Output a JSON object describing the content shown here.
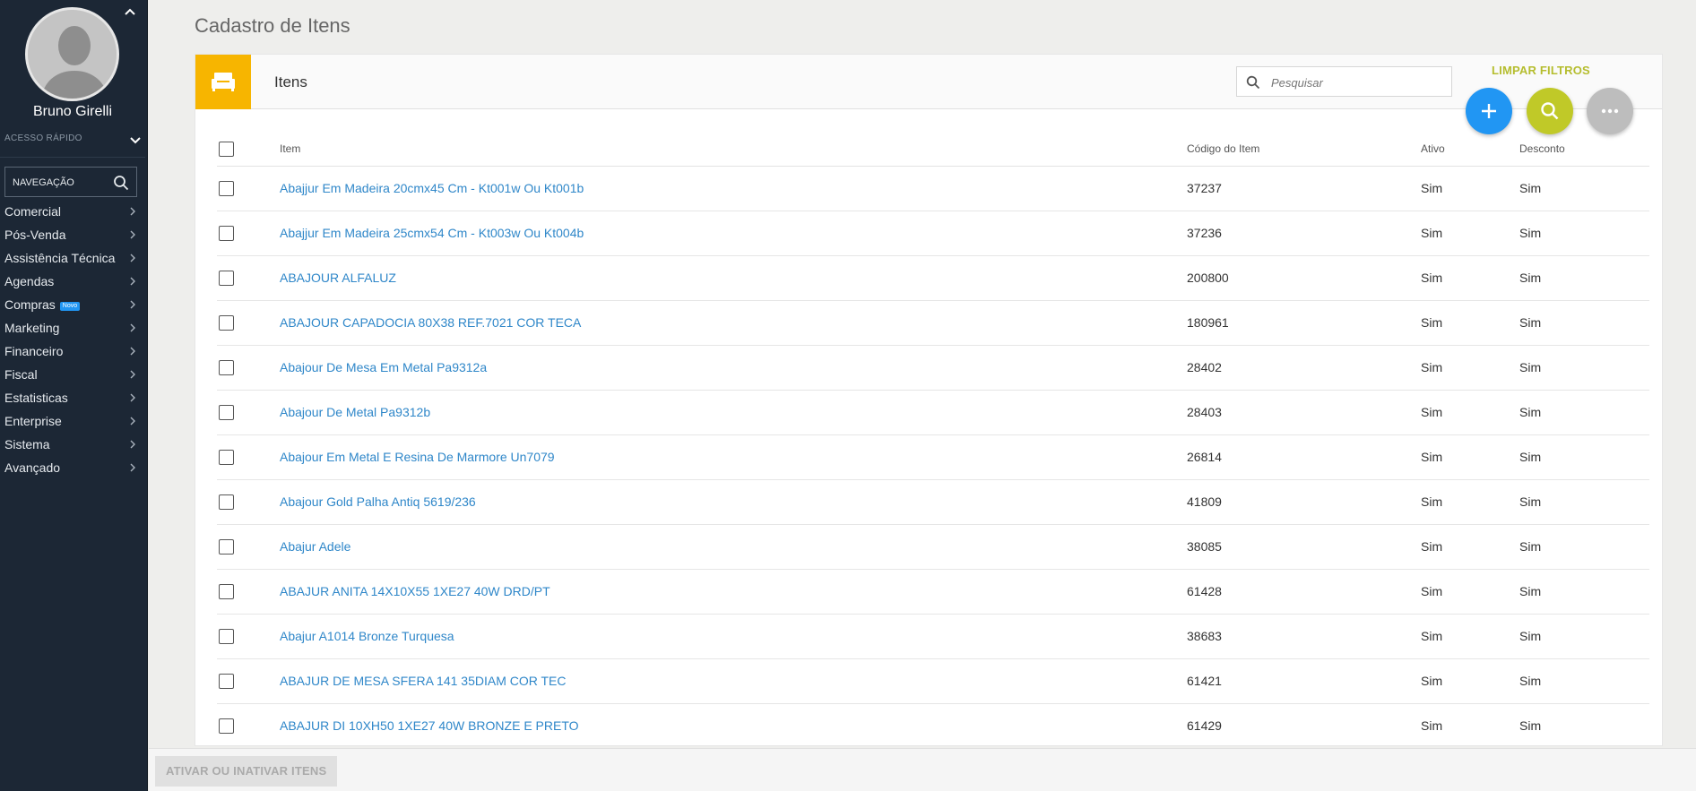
{
  "sidebar": {
    "user_name": "Bruno Girelli",
    "quick_access_label": "ACESSO RÁPIDO",
    "nav_search_label": "NAVEGAÇÃO",
    "items": [
      {
        "label": "Comercial"
      },
      {
        "label": "Pós-Venda"
      },
      {
        "label": "Assistência Técnica"
      },
      {
        "label": "Agendas"
      },
      {
        "label": "Compras",
        "badge": "Novo"
      },
      {
        "label": "Marketing"
      },
      {
        "label": "Financeiro"
      },
      {
        "label": "Fiscal"
      },
      {
        "label": "Estatisticas"
      },
      {
        "label": "Enterprise"
      },
      {
        "label": "Sistema"
      },
      {
        "label": "Avançado"
      }
    ]
  },
  "page": {
    "title": "Cadastro de Itens"
  },
  "card": {
    "title": "Itens",
    "search_placeholder": "Pesquisar",
    "clear_filters": "LIMPAR FILTROS"
  },
  "table": {
    "headers": {
      "item": "Item",
      "code": "Código do Item",
      "active": "Ativo",
      "discount": "Desconto"
    },
    "rows": [
      {
        "item": "Abajjur Em Madeira 20cmx45 Cm - Kt001w Ou Kt001b",
        "code": "37237",
        "active": "Sim",
        "discount": "Sim"
      },
      {
        "item": "Abajjur Em Madeira 25cmx54 Cm - Kt003w Ou Kt004b",
        "code": "37236",
        "active": "Sim",
        "discount": "Sim"
      },
      {
        "item": "ABAJOUR ALFALUZ",
        "code": "200800",
        "active": "Sim",
        "discount": "Sim"
      },
      {
        "item": "ABAJOUR CAPADOCIA 80X38 REF.7021 COR TECA",
        "code": "180961",
        "active": "Sim",
        "discount": "Sim"
      },
      {
        "item": "Abajour De Mesa Em Metal Pa9312a",
        "code": "28402",
        "active": "Sim",
        "discount": "Sim"
      },
      {
        "item": "Abajour De Metal Pa9312b",
        "code": "28403",
        "active": "Sim",
        "discount": "Sim"
      },
      {
        "item": "Abajour Em Metal E Resina De Marmore Un7079",
        "code": "26814",
        "active": "Sim",
        "discount": "Sim"
      },
      {
        "item": "Abajour Gold Palha Antiq 5619/236",
        "code": "41809",
        "active": "Sim",
        "discount": "Sim"
      },
      {
        "item": "Abajur Adele",
        "code": "38085",
        "active": "Sim",
        "discount": "Sim"
      },
      {
        "item": "ABAJUR ANITA 14X10X55 1XE27 40W DRD/PT",
        "code": "61428",
        "active": "Sim",
        "discount": "Sim"
      },
      {
        "item": "Abajur A1014 Bronze Turquesa",
        "code": "38683",
        "active": "Sim",
        "discount": "Sim"
      },
      {
        "item": "ABAJUR DE MESA SFERA 141 35DIAM COR TEC",
        "code": "61421",
        "active": "Sim",
        "discount": "Sim"
      },
      {
        "item": "ABAJUR DI 10XH50 1XE27 40W BRONZE E PRETO",
        "code": "61429",
        "active": "Sim",
        "discount": "Sim"
      }
    ]
  },
  "footer": {
    "toggle_button": "ATIVAR OU INATIVAR ITENS"
  },
  "colors": {
    "sidebar_bg": "#1c2735",
    "link": "#2f87c9",
    "card_icon_bg": "#f7b500",
    "fab_add": "#2196f3",
    "fab_search": "#c0c928",
    "fab_more": "#bdbdbd",
    "clear_filters": "#b5bd2e"
  },
  "icons": {
    "card": "sofa-icon",
    "add": "plus-icon",
    "search": "search-icon",
    "more": "more-horizontal-icon"
  }
}
